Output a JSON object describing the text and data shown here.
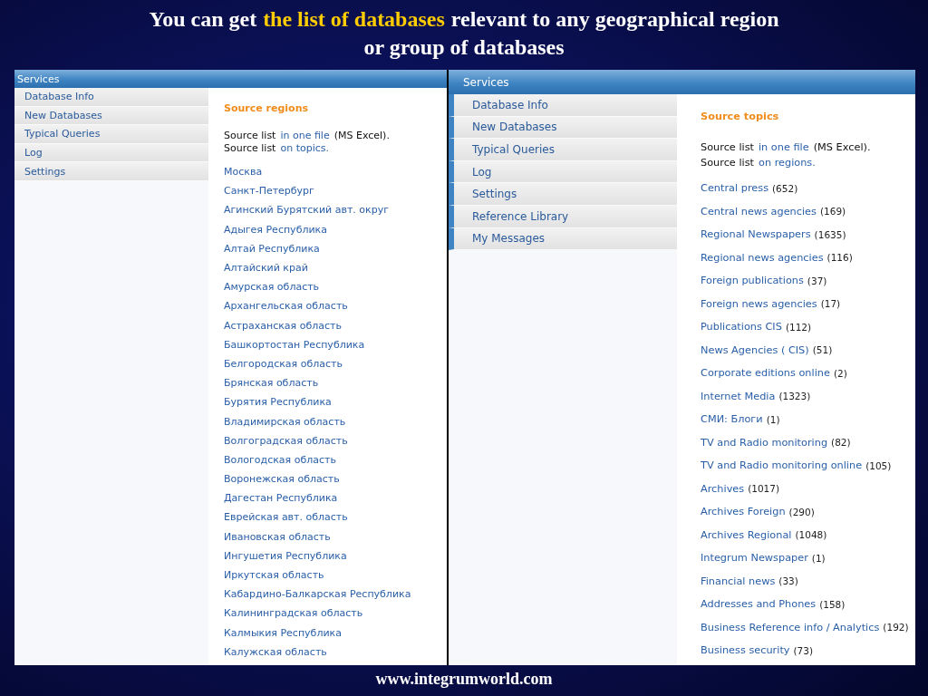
{
  "title": {
    "line1": [
      {
        "text": "You can get",
        "highlight": false
      },
      {
        "text": "the list of databases",
        "highlight": true
      },
      {
        "text": "relevant to any geographical region",
        "highlight": false
      }
    ],
    "line2": "or group of databases"
  },
  "panels": [
    {
      "kind": "regions",
      "header": "Services",
      "menu": [
        "Database Info",
        "New Databases",
        "Typical Queries",
        "Log",
        "Settings"
      ],
      "heading": "Source regions",
      "source_lines": [
        {
          "label": "Source list",
          "link": "in one file",
          "suffix": "(MS Excel)."
        },
        {
          "label": "Source list",
          "link": "on topics."
        }
      ],
      "items": [
        {
          "name": "Москва"
        },
        {
          "name": "Санкт-Петербург"
        },
        {
          "name": "Агинский Бурятский авт. округ"
        },
        {
          "name": "Адыгея Республика"
        },
        {
          "name": "Алтай Республика"
        },
        {
          "name": "Алтайский край"
        },
        {
          "name": "Амурская область"
        },
        {
          "name": "Архангельская область"
        },
        {
          "name": "Астраханская область"
        },
        {
          "name": "Башкортостан Республика"
        },
        {
          "name": "Белгородская область"
        },
        {
          "name": "Брянская область"
        },
        {
          "name": "Бурятия Республика"
        },
        {
          "name": "Владимирская область"
        },
        {
          "name": "Волгоградская область"
        },
        {
          "name": "Вологодская область"
        },
        {
          "name": "Воронежская область"
        },
        {
          "name": "Дагестан Республика"
        },
        {
          "name": "Еврейская авт. область"
        },
        {
          "name": "Ивановская область"
        },
        {
          "name": "Ингушетия Республика"
        },
        {
          "name": "Иркутская область"
        },
        {
          "name": "Кабардино-Балкарская Республика"
        },
        {
          "name": "Калининградская область"
        },
        {
          "name": "Калмыкия Республика"
        },
        {
          "name": "Калужская область"
        }
      ]
    },
    {
      "kind": "topics",
      "header": "Services",
      "menu": [
        "Database Info",
        "New Databases",
        "Typical Queries",
        "Log",
        "Settings",
        "Reference Library",
        "My Messages"
      ],
      "heading": "Source topics",
      "source_lines": [
        {
          "label": "Source list",
          "link": "in one file",
          "suffix": "(MS Excel)."
        },
        {
          "label": "Source list",
          "link": "on regions."
        }
      ],
      "items": [
        {
          "name": "Central press",
          "count": "(652)"
        },
        {
          "name": "Central news agencies",
          "count": "(169)"
        },
        {
          "name": "Regional Newspapers",
          "count": "(1635)"
        },
        {
          "name": "Regional news agencies",
          "count": "(116)"
        },
        {
          "name": "Foreign publications",
          "count": "(37)"
        },
        {
          "name": "Foreign news agencies",
          "count": "(17)"
        },
        {
          "name": "Publications CIS",
          "count": "(112)"
        },
        {
          "name": "News Agencies ( CIS)",
          "count": "(51)"
        },
        {
          "name": "Corporate editions online",
          "count": "(2)"
        },
        {
          "name": "Internet Media",
          "count": "(1323)"
        },
        {
          "name": "СМИ: Блоги",
          "count": "(1)"
        },
        {
          "name": "TV and Radio monitoring",
          "count": "(82)"
        },
        {
          "name": "TV and Radio monitoring online",
          "count": "(105)"
        },
        {
          "name": "Archives",
          "count": "(1017)"
        },
        {
          "name": "Archives Foreign",
          "count": "(290)"
        },
        {
          "name": "Archives Regional",
          "count": "(1048)"
        },
        {
          "name": "Integrum Newspaper",
          "count": "(1)"
        },
        {
          "name": "Financial news",
          "count": "(33)"
        },
        {
          "name": "Addresses and Phones",
          "count": "(158)"
        },
        {
          "name": "Business Reference info / Analytics",
          "count": "(192)"
        },
        {
          "name": "Business security",
          "count": "(73)"
        }
      ]
    }
  ],
  "footer": "www.integrumworld.com"
}
